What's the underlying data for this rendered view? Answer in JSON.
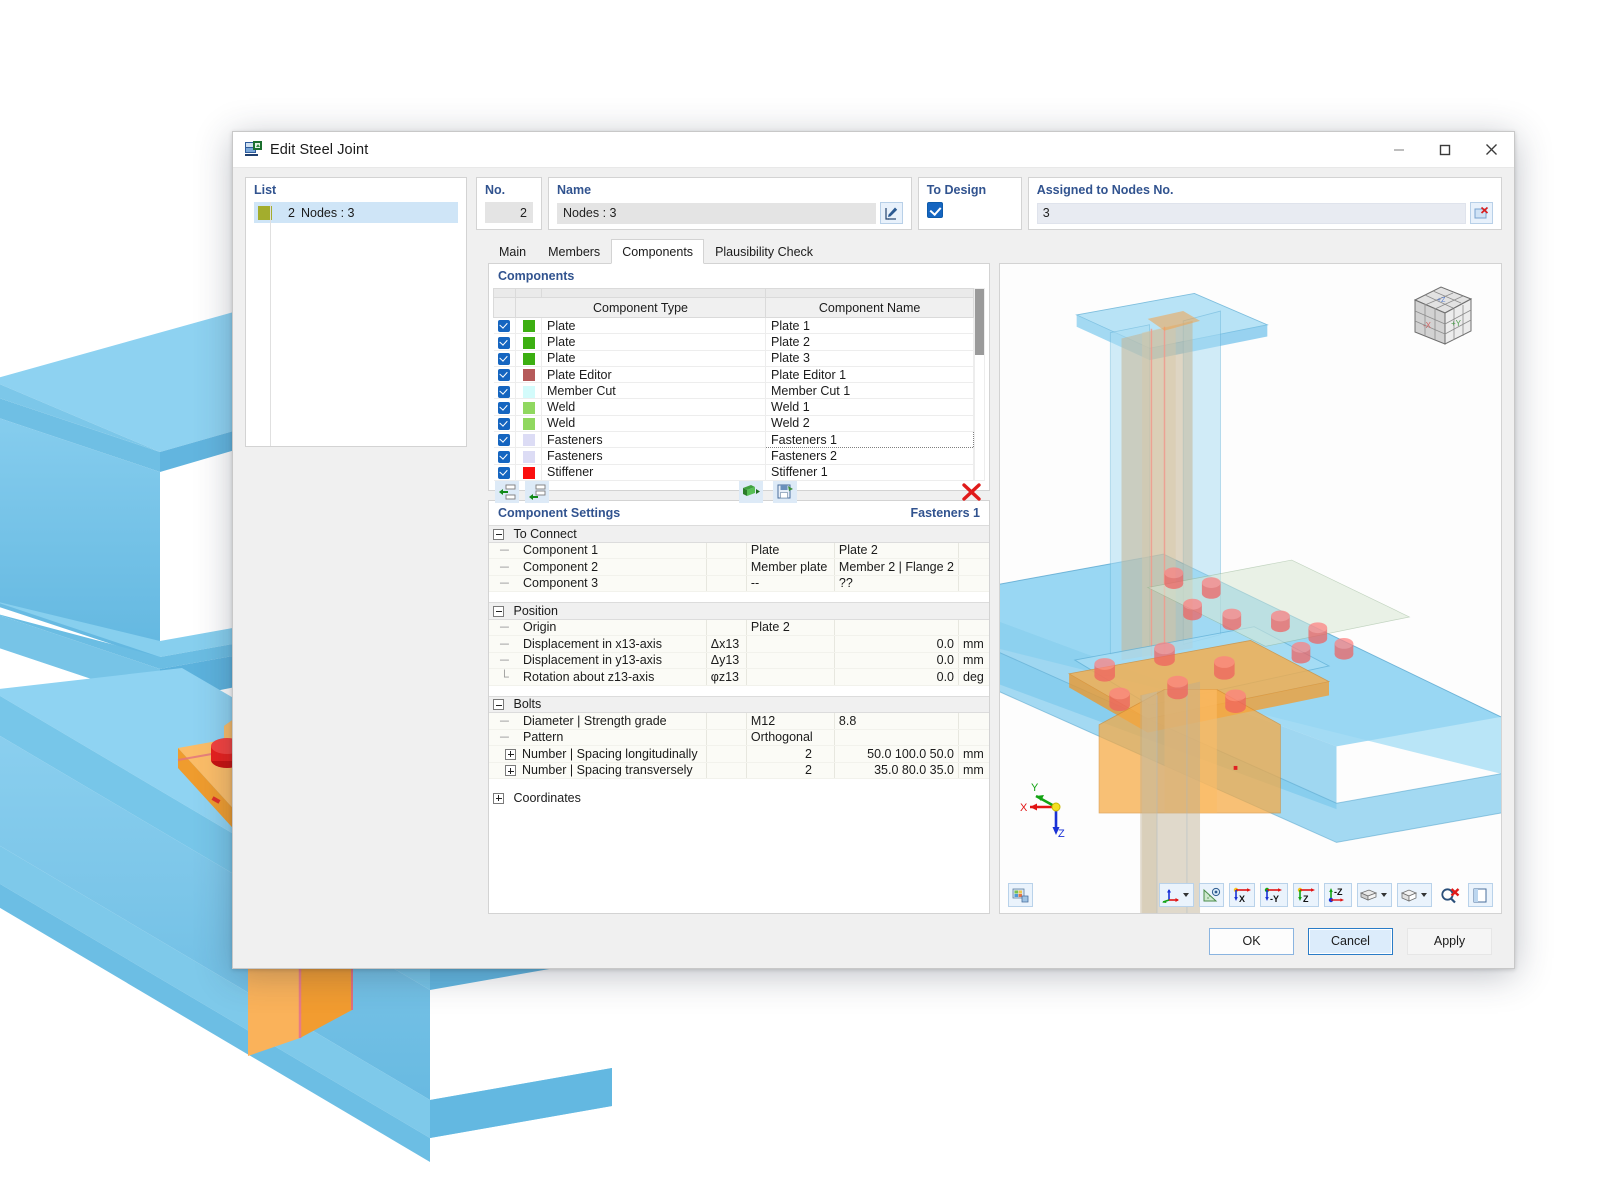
{
  "window": {
    "title": "Edit Steel Joint",
    "icon": "steel-joint-icon",
    "minimize": "—",
    "maximize": "☐",
    "close": "✕"
  },
  "list_panel": {
    "header": "List",
    "items": [
      {
        "swatch": "#a3ad2d",
        "number": "2",
        "label": "Nodes : 3",
        "selected": true
      }
    ]
  },
  "header_fields": {
    "no_label": "No.",
    "no_value": "2",
    "name_label": "Name",
    "name_value": "Nodes : 3",
    "name_edit_icon": "pencil-edit-icon",
    "to_design_label": "To Design",
    "to_design_checked": true,
    "assigned_label": "Assigned to Nodes No.",
    "assigned_value": "3",
    "assigned_pick_icon": "pick-nodes-icon"
  },
  "tabs": [
    {
      "label": "Main",
      "active": false
    },
    {
      "label": "Members",
      "active": false
    },
    {
      "label": "Components",
      "active": true
    },
    {
      "label": "Plausibility Check",
      "active": false
    }
  ],
  "components_panel": {
    "title": "Components",
    "columns": [
      "Component Type",
      "Component Name"
    ],
    "rows": [
      {
        "checked": true,
        "color": "#3caf12",
        "type": "Plate",
        "name": "Plate 1",
        "editing": false
      },
      {
        "checked": true,
        "color": "#3caf12",
        "type": "Plate",
        "name": "Plate 2",
        "editing": false
      },
      {
        "checked": true,
        "color": "#3caf12",
        "type": "Plate",
        "name": "Plate 3",
        "editing": false
      },
      {
        "checked": true,
        "color": "#b55a5a",
        "type": "Plate Editor",
        "name": "Plate Editor 1",
        "editing": false
      },
      {
        "checked": true,
        "color": "#d3fbfb",
        "type": "Member Cut",
        "name": "Member Cut 1",
        "editing": false
      },
      {
        "checked": true,
        "color": "#90d860",
        "type": "Weld",
        "name": "Weld 1",
        "editing": false
      },
      {
        "checked": true,
        "color": "#90d860",
        "type": "Weld",
        "name": "Weld 2",
        "editing": false
      },
      {
        "checked": true,
        "color": "#dcdcf5",
        "type": "Fasteners",
        "name": "Fasteners 1",
        "editing": true
      },
      {
        "checked": true,
        "color": "#dcdcf5",
        "type": "Fasteners",
        "name": "Fasteners 2",
        "editing": false
      },
      {
        "checked": true,
        "color": "#fb0f0f",
        "type": "Stiffener",
        "name": "Stiffener 1",
        "editing": false
      }
    ],
    "toolbar": [
      {
        "name": "insert-component-before-icon"
      },
      {
        "name": "insert-component-after-icon"
      },
      {
        "name": "import-component-icon"
      },
      {
        "name": "save-component-icon"
      },
      {
        "name": "delete-component-icon"
      }
    ]
  },
  "component_settings": {
    "title": "Component Settings",
    "subject": "Fasteners 1",
    "groups": [
      {
        "name": "To Connect",
        "expanded": true,
        "rows": [
          {
            "label": "Component 1",
            "symbol": "",
            "v1": "Plate",
            "v2": "Plate 2",
            "unit": ""
          },
          {
            "label": "Component 2",
            "symbol": "",
            "v1": "Member plate",
            "v2": "Member 2 | Flange 2",
            "unit": ""
          },
          {
            "label": "Component 3",
            "symbol": "",
            "v1": "--",
            "v2": "??",
            "unit": ""
          }
        ]
      },
      {
        "name": "Position",
        "expanded": true,
        "rows": [
          {
            "label": "Origin",
            "symbol": "",
            "v1": "Plate 2",
            "v2": "",
            "unit": ""
          },
          {
            "label": "Displacement in x13-axis",
            "symbol": "Δx13",
            "v1": "",
            "v2": "0.0",
            "unit": "mm"
          },
          {
            "label": "Displacement in y13-axis",
            "symbol": "Δy13",
            "v1": "",
            "v2": "0.0",
            "unit": "mm"
          },
          {
            "label": "Rotation about z13-axis",
            "symbol": "φz13",
            "v1": "",
            "v2": "0.0",
            "unit": "deg"
          }
        ]
      },
      {
        "name": "Bolts",
        "expanded": true,
        "rows": [
          {
            "label": "Diameter | Strength grade",
            "symbol": "",
            "v1": "M12",
            "v2": "8.8",
            "unit": "",
            "expander": "none"
          },
          {
            "label": "Pattern",
            "symbol": "",
            "v1": "Orthogonal",
            "v2": "",
            "unit": "",
            "expander": "none"
          },
          {
            "label": "Number | Spacing longitudinally",
            "symbol": "",
            "v1": "2",
            "v2": "50.0 100.0 50.0",
            "unit": "mm",
            "expander": "plus"
          },
          {
            "label": "Number | Spacing transversely",
            "symbol": "",
            "v1": "2",
            "v2": "35.0 80.0 35.0",
            "unit": "mm",
            "expander": "plus"
          }
        ]
      },
      {
        "name": "Coordinates",
        "expanded": false,
        "rows": []
      }
    ]
  },
  "viewport": {
    "nav_cube_labels": {
      "left": "-X",
      "front": "+Y",
      "top": "+Z"
    },
    "axis_labels": {
      "x": "X",
      "y": "Y",
      "z": "Z"
    },
    "toolbar_left": [
      {
        "name": "render-mode-icon"
      }
    ],
    "toolbar_right": [
      {
        "name": "coordinate-system-icon",
        "dropdown": true
      },
      {
        "name": "measure-icon",
        "dropdown": false
      },
      {
        "name": "view-in-x-icon",
        "label": "X",
        "dropdown": false
      },
      {
        "name": "view-in-neg-y-icon",
        "label": "-Y",
        "dropdown": false
      },
      {
        "name": "view-in-z-icon",
        "label": "Z",
        "dropdown": false
      },
      {
        "name": "view-in-neg-z-icon",
        "label": "-Z",
        "dropdown": false
      },
      {
        "name": "display-mode-icon",
        "dropdown": true
      },
      {
        "name": "transparency-icon",
        "dropdown": true
      },
      {
        "name": "zoom-reset-icon",
        "dropdown": false
      },
      {
        "name": "panel-toggle-icon",
        "dropdown": false
      }
    ]
  },
  "footer_buttons": [
    {
      "label": "OK",
      "name": "ok-button",
      "style": "default"
    },
    {
      "label": "Cancel",
      "name": "cancel-button",
      "style": "focus"
    },
    {
      "label": "Apply",
      "name": "apply-button",
      "style": "plain"
    }
  ],
  "colors": {
    "accent": "#31538f",
    "checkbox": "#1565c0",
    "steel_blue": "#79c5ea",
    "plate_orange": "#f5a33c",
    "bolt_red": "#e8201d",
    "delete_red": "#e01b1b"
  }
}
